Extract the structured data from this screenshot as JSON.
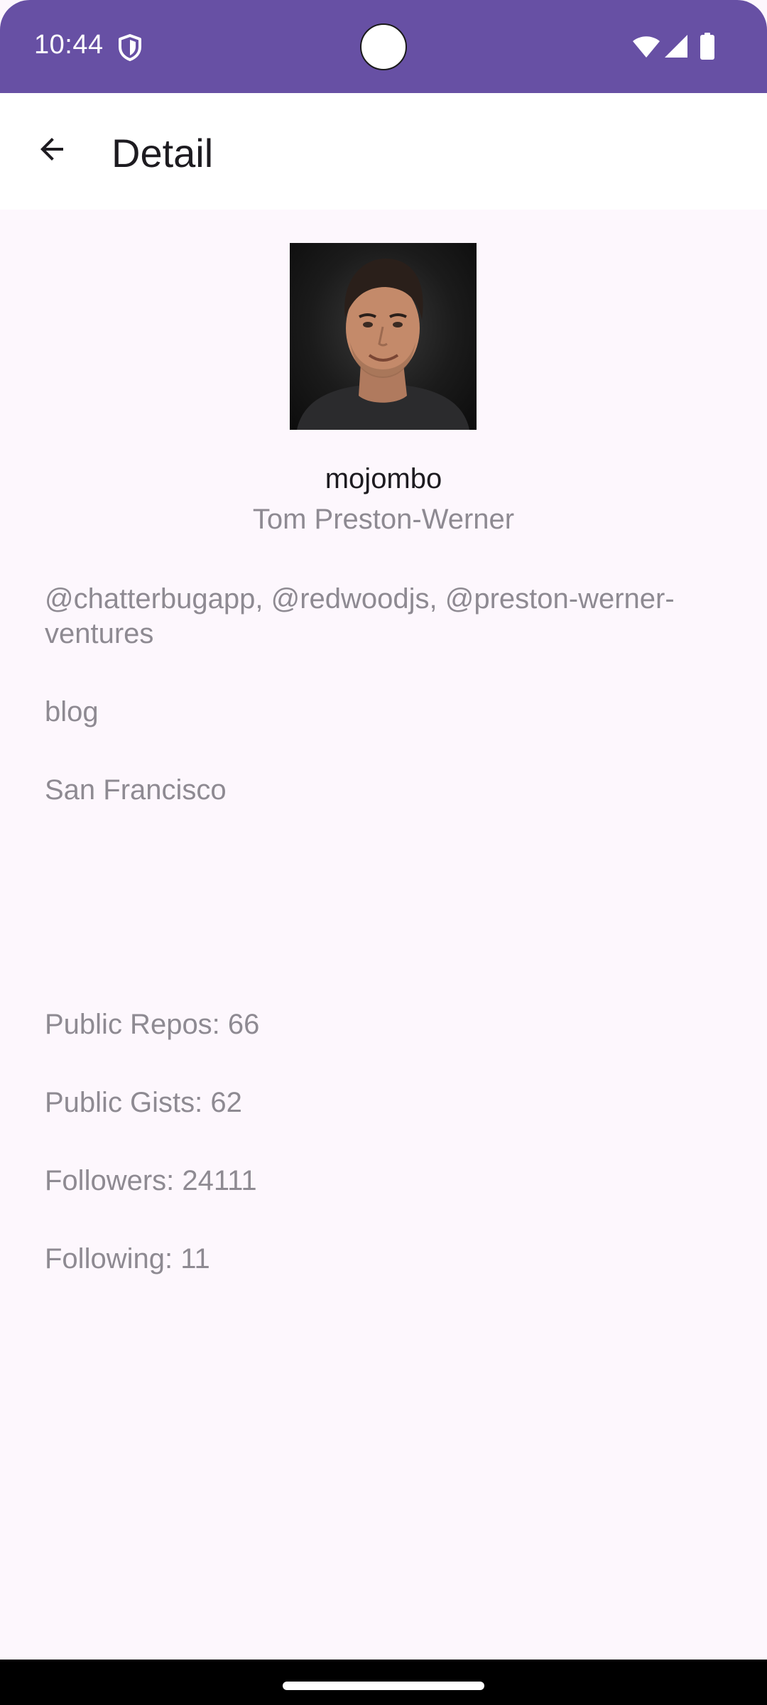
{
  "status_bar": {
    "time": "10:44",
    "background_color": "#6750A4",
    "icons": [
      "shield-icon",
      "wifi-icon",
      "signal-icon",
      "battery-icon"
    ]
  },
  "app_bar": {
    "title": "Detail",
    "back_icon": "arrow-back-icon"
  },
  "profile": {
    "login": "mojombo",
    "name": "Tom Preston-Werner",
    "company": "@chatterbugapp, @redwoodjs, @preston-werner-ventures",
    "blog": "blog",
    "location": "San Francisco",
    "public_repos": "Public Repos: 66",
    "public_gists": "Public Gists: 62",
    "followers": "Followers: 24111",
    "following": "Following: 11"
  },
  "colors": {
    "accent": "#6750A4",
    "page_background": "#FDF7FD",
    "secondary_text": "#8E8A92",
    "primary_text": "#1D1B20"
  }
}
